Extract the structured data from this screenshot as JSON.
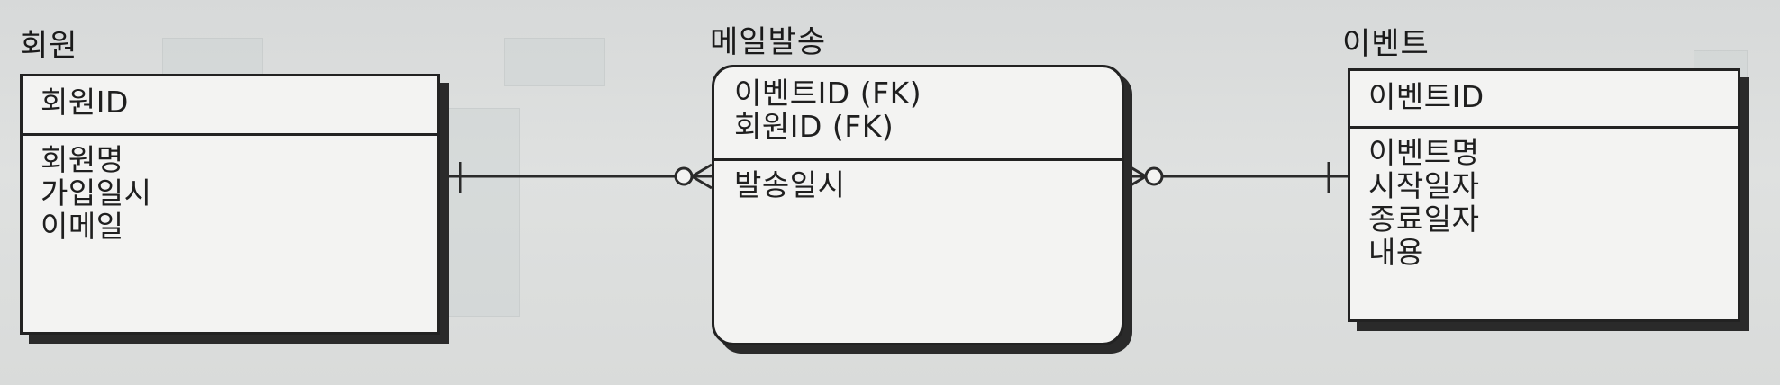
{
  "entities": {
    "member": {
      "title": "회원",
      "keys": [
        "회원ID"
      ],
      "attributes": [
        "회원명",
        "가입일시",
        "이메일"
      ]
    },
    "mail": {
      "title": "메일발송",
      "keys": [
        "이벤트ID (FK)",
        "회원ID (FK)"
      ],
      "attributes": [
        "발송일시"
      ]
    },
    "event": {
      "title": "이벤트",
      "keys": [
        "이벤트ID"
      ],
      "attributes": [
        "이벤트명",
        "시작일자",
        "종료일자",
        "내용"
      ]
    }
  },
  "relationships": [
    {
      "from": "회원",
      "to": "메일발송",
      "from_symbol": "one",
      "to_symbol": "zero-or-many"
    },
    {
      "from": "이벤트",
      "to": "메일발송",
      "from_symbol": "one",
      "to_symbol": "zero-or-many"
    }
  ]
}
